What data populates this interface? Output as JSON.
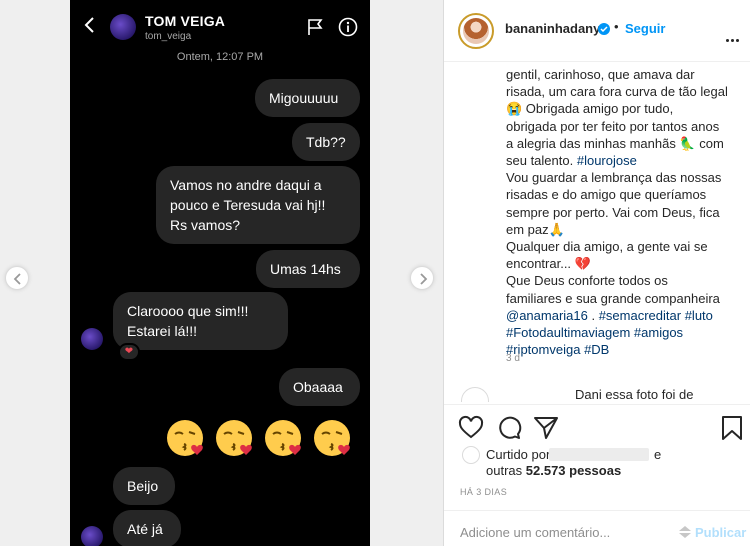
{
  "dm": {
    "contact_name": "TOM VEIGA",
    "contact_handle": "tom_veiga",
    "timestamp": "Ontem, 12:07 PM",
    "messages": [
      {
        "text": "Migouuuuu"
      },
      {
        "text": "Tdb??"
      },
      {
        "text": "Vamos no andre daqui a\npouco e Teresuda vai hj!!\nRs vamos?"
      },
      {
        "text": "Umas 14hs"
      },
      {
        "text": "Claroooo que sim!!!\nEstarei lá!!!"
      },
      {
        "text": "Obaaaa"
      },
      {
        "text": "Beijo"
      },
      {
        "text": "Até já"
      }
    ],
    "reaction": "❤"
  },
  "post": {
    "username": "bananinhadany",
    "follow_label": "Seguir",
    "separator": "•",
    "caption": {
      "line1": "gentil, carinhoso, que amava dar",
      "line2": "risada, um cara fora curva de tão legal",
      "line3": "😭 Obrigada amigo por tudo,",
      "line4": "obrigada por ter feito por tantos anos",
      "line5": "a alegria das minhas manhãs 🦜 com",
      "line6": "seu talento.",
      "tag_louro": "#lourojose",
      "line7": "Vou guardar a lembrança das nossas",
      "line8": "risadas e do amigo que queríamos",
      "line9": "sempre por perto. Vai com Deus, fica",
      "line10": "em paz🙏",
      "line11": "Qualquer dia amigo, a gente vai se",
      "line12": "encontrar... 💔",
      "line13": "Que Deus conforte todos os",
      "line14": "familiares e sua grande companheira",
      "mention": "@anamaria16",
      "tag_semacreditar": "#semacreditar",
      "tag_luto": "#luto",
      "tag_foto": "#Fotodaultimaviagem",
      "tag_amigos": "#amigos",
      "tag_rip": "#riptomveiga",
      "tag_db": "#DB"
    },
    "caption_age": "3 d",
    "comment_preview": "Dani essa foto foi de",
    "likes_prefix": "Curtido por",
    "likes_suffix_e": "e",
    "likes_others_prefix": "outras",
    "likes_count": "52.573 pessoas",
    "post_date": "HÁ 3 DIAS",
    "comment_placeholder": "Adicione um comentário...",
    "publish_label": "Publicar"
  }
}
